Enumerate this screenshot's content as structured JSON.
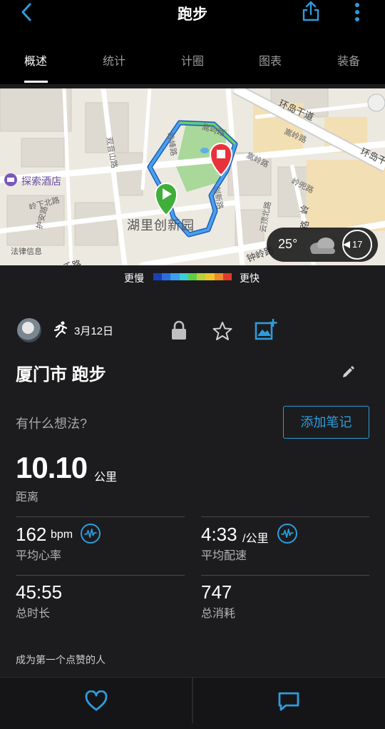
{
  "header": {
    "title": "跑步"
  },
  "tabs": [
    "概述",
    "统计",
    "计圈",
    "图表",
    "装备"
  ],
  "map": {
    "street_labels": [
      "环岛干道",
      "环岛干",
      "嵩屿路",
      "岭下北路",
      "护安路",
      "嵩岭路",
      "岭兜路",
      "钟岭路",
      "云顶北路",
      "创新路",
      "观音山路",
      "岭",
      "路",
      "岭峰路",
      "千路",
      "嵩岭路"
    ],
    "hotel_name": "探索酒店",
    "park_name": "湖里创新园",
    "legal_text": "法律信息",
    "weather": {
      "temperature": "25°",
      "wind_speed": "17"
    }
  },
  "speed_legend": {
    "slow_label": "更慢",
    "fast_label": "更快",
    "colors": [
      "#1a3fb8",
      "#2a6ee0",
      "#3aa0f0",
      "#3ccfd8",
      "#5ccf4a",
      "#b8d23c",
      "#f0c630",
      "#f08a2a",
      "#e03a2a"
    ]
  },
  "activity": {
    "date": "3月12日",
    "title": "厦门市 跑步",
    "thoughts_prompt": "有什么想法?",
    "add_note_label": "添加笔记"
  },
  "stats": {
    "distance": {
      "value": "10.10",
      "unit": "公里",
      "label": "距离"
    },
    "heart_rate": {
      "value": "162",
      "unit": "bpm",
      "label": "平均心率"
    },
    "pace": {
      "value": "4:33",
      "unit": "/公里",
      "label": "平均配速"
    },
    "duration": {
      "value": "45:55",
      "label": "总时长"
    },
    "calories": {
      "value": "747",
      "label": "总消耗"
    }
  },
  "likes_text": "成为第一个点赞的人",
  "colors": {
    "accent": "#2d9cdb",
    "background": "#1c1c1e",
    "start_marker": "#3fae3a",
    "end_marker": "#e8323a",
    "route": "#2b7fd6"
  }
}
